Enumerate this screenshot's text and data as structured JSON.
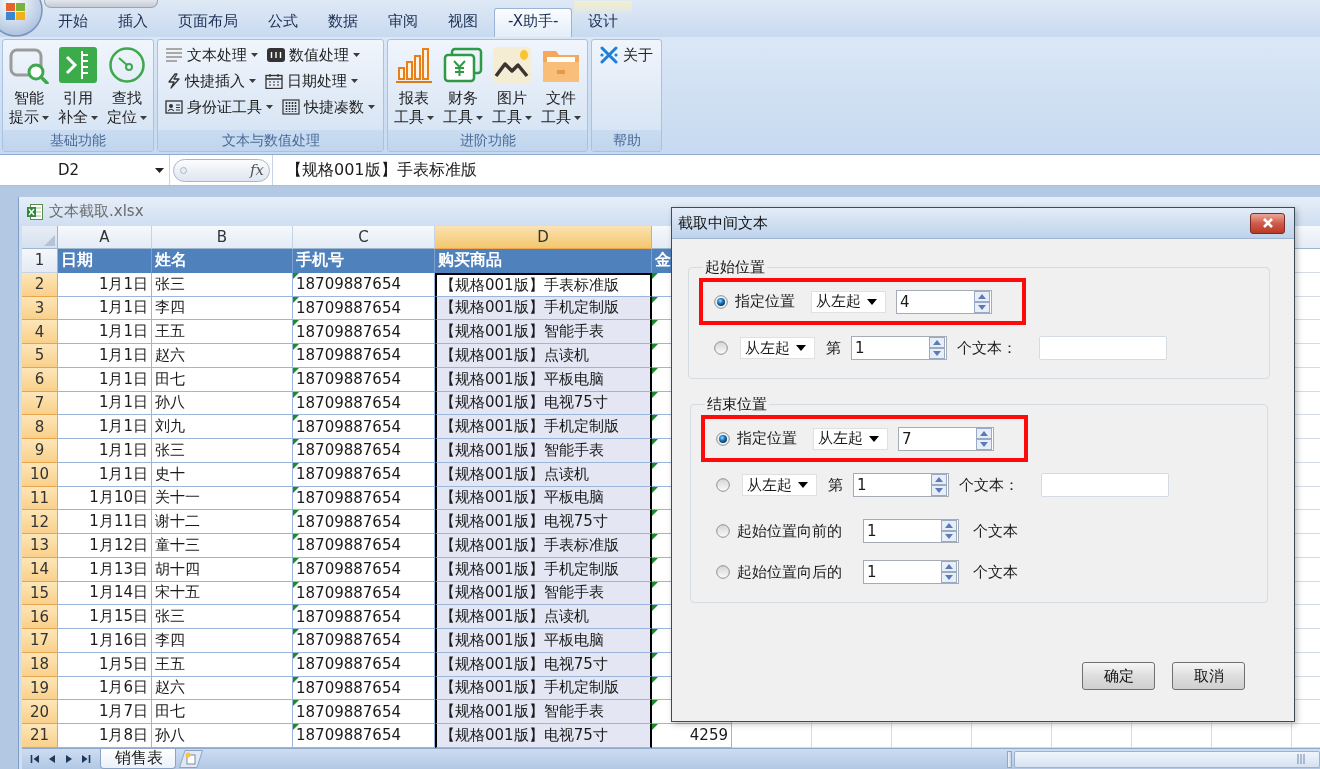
{
  "ribbon_tabs": [
    {
      "label": "开始",
      "selected": false,
      "kind": "normal"
    },
    {
      "label": "插入",
      "selected": false,
      "kind": "normal"
    },
    {
      "label": "页面布局",
      "selected": false,
      "kind": "normal"
    },
    {
      "label": "公式",
      "selected": false,
      "kind": "normal"
    },
    {
      "label": "数据",
      "selected": false,
      "kind": "normal"
    },
    {
      "label": "审阅",
      "selected": false,
      "kind": "normal"
    },
    {
      "label": "视图",
      "selected": false,
      "kind": "normal"
    },
    {
      "label": "-X助手-",
      "selected": true,
      "kind": "normal"
    },
    {
      "label": "设计",
      "selected": false,
      "kind": "contextual"
    }
  ],
  "ribbon": {
    "groups": [
      {
        "title": "基础功能",
        "kind": "large",
        "buttons": [
          {
            "lines": [
              "智能",
              "提示"
            ],
            "dropdown": true
          },
          {
            "lines": [
              "引用",
              "补全"
            ],
            "dropdown": true
          },
          {
            "lines": [
              "查找",
              "定位"
            ],
            "dropdown": true
          }
        ]
      },
      {
        "title": "文本与数值处理",
        "kind": "small",
        "rows": [
          [
            {
              "label": "文本处理",
              "dropdown": true
            },
            {
              "label": "数值处理",
              "dropdown": true
            }
          ],
          [
            {
              "label": "快捷插入",
              "dropdown": true
            },
            {
              "label": "日期处理",
              "dropdown": true
            }
          ],
          [
            {
              "label": "身份证工具",
              "dropdown": true
            },
            {
              "label": "快捷凑数",
              "dropdown": true
            }
          ]
        ]
      },
      {
        "title": "进阶功能",
        "kind": "large",
        "buttons": [
          {
            "lines": [
              "报表",
              "工具"
            ],
            "dropdown": true
          },
          {
            "lines": [
              "财务",
              "工具"
            ],
            "dropdown": true
          },
          {
            "lines": [
              "图片",
              "工具"
            ],
            "dropdown": true
          },
          {
            "lines": [
              "文件",
              "工具"
            ],
            "dropdown": true
          }
        ]
      },
      {
        "title": "帮助",
        "kind": "small",
        "rows": [
          [
            {
              "label": "关于",
              "dropdown": false
            }
          ]
        ]
      }
    ]
  },
  "formula_bar": {
    "name_box": "D2",
    "function_label": "fx",
    "formula": "【规格001版】手表标准版"
  },
  "workbook": {
    "title": "文本截取.xlsx",
    "columns": [
      {
        "letter": "A",
        "kind": "date",
        "selected": false,
        "flagged": false
      },
      {
        "letter": "B",
        "kind": "text",
        "selected": false,
        "flagged": false
      },
      {
        "letter": "C",
        "kind": "text",
        "selected": false,
        "flagged": true
      },
      {
        "letter": "D",
        "kind": "text",
        "selected": true,
        "flagged": false
      },
      {
        "kind": "number",
        "selected": false,
        "flagged": true
      }
    ],
    "rows": [
      {
        "number": "1",
        "kind": "header",
        "selected": false,
        "cells": [
          "日期",
          "姓名",
          "手机号",
          "购买商品",
          "金"
        ]
      },
      {
        "number": "2",
        "kind": "data",
        "selected": true,
        "cells": [
          "1月1日",
          "张三",
          "18709887654",
          "【规格001版】手表标准版"
        ]
      },
      {
        "number": "3",
        "kind": "data",
        "selected": true,
        "cells": [
          "1月1日",
          "李四",
          "18709887654",
          "【规格001版】手机定制版"
        ]
      },
      {
        "number": "4",
        "kind": "data",
        "selected": true,
        "cells": [
          "1月1日",
          "王五",
          "18709887654",
          "【规格001版】智能手表"
        ]
      },
      {
        "number": "5",
        "kind": "data",
        "selected": true,
        "cells": [
          "1月1日",
          "赵六",
          "18709887654",
          "【规格001版】点读机"
        ]
      },
      {
        "number": "6",
        "kind": "data",
        "selected": true,
        "cells": [
          "1月1日",
          "田七",
          "18709887654",
          "【规格001版】平板电脑"
        ]
      },
      {
        "number": "7",
        "kind": "data",
        "selected": true,
        "cells": [
          "1月1日",
          "孙八",
          "18709887654",
          "【规格001版】电视75寸"
        ]
      },
      {
        "number": "8",
        "kind": "data",
        "selected": true,
        "cells": [
          "1月1日",
          "刘九",
          "18709887654",
          "【规格001版】手机定制版"
        ]
      },
      {
        "number": "9",
        "kind": "data",
        "selected": true,
        "cells": [
          "1月1日",
          "张三",
          "18709887654",
          "【规格001版】智能手表"
        ]
      },
      {
        "number": "10",
        "kind": "data",
        "selected": true,
        "cells": [
          "1月1日",
          "史十",
          "18709887654",
          "【规格001版】点读机"
        ]
      },
      {
        "number": "11",
        "kind": "data",
        "selected": true,
        "cells": [
          "1月10日",
          "关十一",
          "18709887654",
          "【规格001版】平板电脑"
        ]
      },
      {
        "number": "12",
        "kind": "data",
        "selected": true,
        "cells": [
          "1月11日",
          "谢十二",
          "18709887654",
          "【规格001版】电视75寸"
        ]
      },
      {
        "number": "13",
        "kind": "data",
        "selected": true,
        "cells": [
          "1月12日",
          "童十三",
          "18709887654",
          "【规格001版】手表标准版"
        ]
      },
      {
        "number": "14",
        "kind": "data",
        "selected": true,
        "cells": [
          "1月13日",
          "胡十四",
          "18709887654",
          "【规格001版】手机定制版"
        ]
      },
      {
        "number": "15",
        "kind": "data",
        "selected": true,
        "cells": [
          "1月14日",
          "宋十五",
          "18709887654",
          "【规格001版】智能手表"
        ]
      },
      {
        "number": "16",
        "kind": "data",
        "selected": true,
        "cells": [
          "1月15日",
          "张三",
          "18709887654",
          "【规格001版】点读机"
        ]
      },
      {
        "number": "17",
        "kind": "data",
        "selected": true,
        "cells": [
          "1月16日",
          "李四",
          "18709887654",
          "【规格001版】平板电脑"
        ]
      },
      {
        "number": "18",
        "kind": "data",
        "selected": true,
        "cells": [
          "1月5日",
          "王五",
          "18709887654",
          "【规格001版】电视75寸"
        ]
      },
      {
        "number": "19",
        "kind": "data",
        "selected": true,
        "cells": [
          "1月6日",
          "赵六",
          "18709887654",
          "【规格001版】手机定制版"
        ]
      },
      {
        "number": "20",
        "kind": "data",
        "selected": true,
        "cells": [
          "1月7日",
          "田七",
          "18709887654",
          "【规格001版】智能手表"
        ]
      },
      {
        "number": "21",
        "kind": "data",
        "selected": true,
        "cells": [
          "1月8日",
          "孙八",
          "18709887654",
          "【规格001版】电视75寸",
          "4259"
        ]
      }
    ],
    "sheet_tabs": [
      {
        "label": "销售表",
        "selected": true
      }
    ]
  },
  "dialog": {
    "title": "截取中间文本",
    "groups": [
      {
        "title": "起始位置",
        "options": [
          {
            "kind": "position",
            "selected": true,
            "highlighted": true,
            "label": "指定位置",
            "direction": "从左起",
            "value": "4"
          },
          {
            "kind": "nth",
            "selected": false,
            "highlighted": false,
            "direction": "从左起",
            "prefix": "第",
            "value": "1",
            "suffix": "个文本："
          }
        ]
      },
      {
        "title": "结束位置",
        "options": [
          {
            "kind": "position",
            "selected": true,
            "highlighted": true,
            "label": "指定位置",
            "direction": "从左起",
            "value": "7"
          },
          {
            "kind": "nth",
            "selected": false,
            "highlighted": false,
            "direction": "从左起",
            "prefix": "第",
            "value": "1",
            "suffix": "个文本："
          },
          {
            "kind": "offset",
            "selected": false,
            "highlighted": false,
            "label": "起始位置向前的",
            "value": "1",
            "suffix": "个文本"
          },
          {
            "kind": "offset",
            "selected": false,
            "highlighted": false,
            "label": "起始位置向后的",
            "value": "1",
            "suffix": "个文本"
          }
        ]
      }
    ],
    "buttons": [
      "确定",
      "取消"
    ]
  }
}
